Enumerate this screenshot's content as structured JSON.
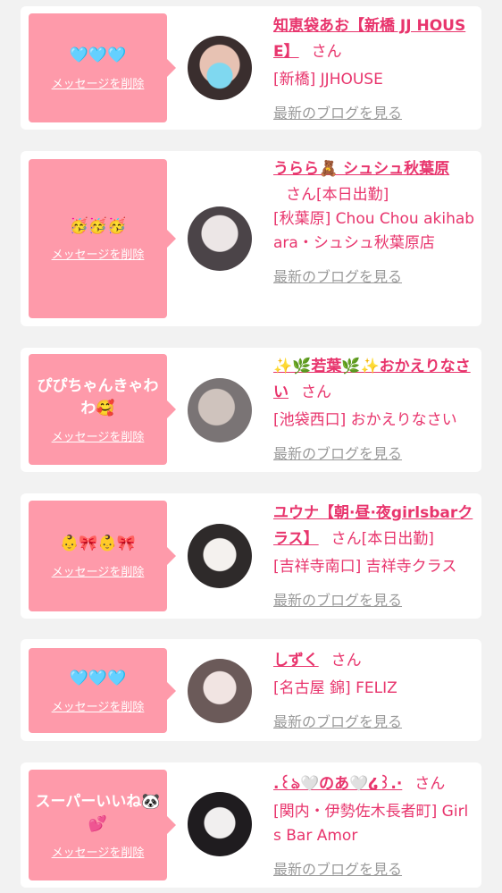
{
  "delete_label": "メッセージを削除",
  "blog_label": "最新のブログを見る",
  "san_label": "さん",
  "colors": {
    "background": "#f2f2f2",
    "card": "#ffffff",
    "bubble": "#fe9aaa",
    "name_text": "#e8356d",
    "blog_link": "#9a9a9a"
  },
  "items": [
    {
      "message": "🩵🩵🩵",
      "name": "知恵袋あお【新橋 JJ HOUSE】",
      "status": "",
      "shop": "[新橋] JJHOUSE",
      "avatar_icon": "avatar-photo"
    },
    {
      "message": "🥳🥳🥳",
      "name": "うらら🧸 シュシュ秋葉原",
      "status": "[本日出勤]",
      "shop": "[秋葉原] Chou Chou akihabara・シュシュ秋葉原店",
      "avatar_icon": "avatar-photo"
    },
    {
      "message": "ぴぴちゃんきゃわわ🥰",
      "name": "✨🌿若葉🌿✨おかえりなさい",
      "status": "",
      "shop": "[池袋西口] おかえりなさい",
      "avatar_icon": "avatar-photo"
    },
    {
      "message": "👶🎀👶🎀",
      "name": "ユウナ【朝·昼·夜girlsbarクラス】",
      "status": "[本日出勤]",
      "shop": "[吉祥寺南口] 吉祥寺クラス",
      "avatar_icon": "avatar-photo"
    },
    {
      "message": "🩵🩵🩵",
      "name": "しずく",
      "status": "",
      "shop": "[名古屋 錦] FELIZ",
      "avatar_icon": "avatar-photo"
    },
    {
      "message": "スーパーいいね🐼💕",
      "name": ".꒰ঌ🤍のあ🤍໒꒱.·",
      "status": "",
      "shop": "[関内・伊勢佐木長者町] Girls Bar Amor",
      "avatar_icon": "avatar-photo"
    }
  ]
}
